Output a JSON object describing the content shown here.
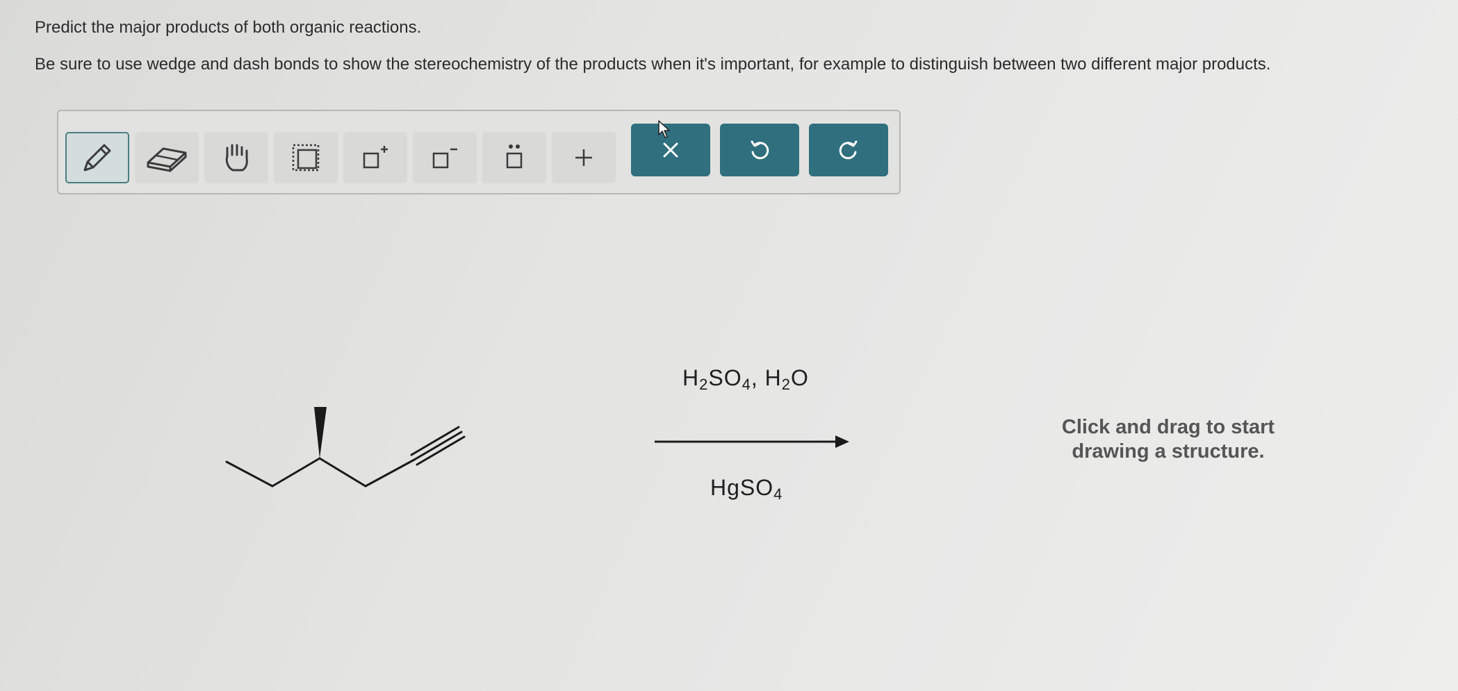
{
  "question": {
    "title": "Predict the major products of both organic reactions.",
    "instruction": "Be sure to use wedge and dash bonds to show the stereochemistry of the products when it's important, for example to distinguish between two different major products."
  },
  "toolbar": {
    "tools": [
      {
        "name": "pencil-tool",
        "icon": "pencil-icon"
      },
      {
        "name": "eraser-tool",
        "icon": "eraser-icon"
      },
      {
        "name": "hand-tool",
        "icon": "hand-icon"
      },
      {
        "name": "select-tool",
        "icon": "dotted-square-icon"
      },
      {
        "name": "positive-charge-tool",
        "icon": "square-plus-icon",
        "label": "+"
      },
      {
        "name": "negative-charge-tool",
        "icon": "square-minus-icon",
        "label": "−"
      },
      {
        "name": "lone-pair-tool",
        "icon": "square-dots-icon"
      },
      {
        "name": "add-tool",
        "icon": "plus-icon",
        "label": "+"
      }
    ],
    "clear_label": "✕",
    "undo_label": "↺",
    "redo_label": "↻",
    "accent_color": "#2f6f7e"
  },
  "reaction": {
    "reagents_top": {
      "H": "H",
      "sub1": "2",
      "SO": "SO",
      "sub2": "4",
      "comma": ",",
      "H2": "H",
      "sub3": "2",
      "O": "O"
    },
    "reagents_bottom": {
      "Hg": "HgSO",
      "sub": "4"
    }
  },
  "drawing_area": {
    "hint_line1": "Click and drag to start",
    "hint_line2": "drawing a structure."
  }
}
